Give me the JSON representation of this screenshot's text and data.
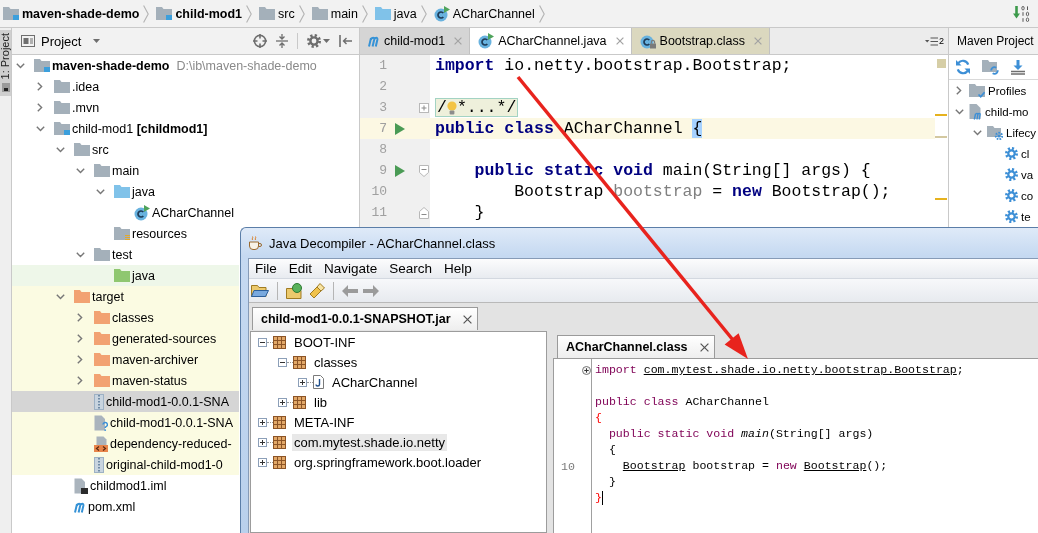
{
  "breadcrumbs": [
    {
      "label": "maven-shade-demo",
      "kind": "module"
    },
    {
      "label": "child-mod1",
      "kind": "module"
    },
    {
      "label": "src",
      "kind": "folder"
    },
    {
      "label": "main",
      "kind": "folder"
    },
    {
      "label": "java",
      "kind": "source-folder"
    },
    {
      "label": "ACharChannel",
      "kind": "class"
    }
  ],
  "tool_window_bar": {
    "buttons": [
      {
        "label": "1: Project",
        "selected": true
      }
    ]
  },
  "project_panel": {
    "title": "Project",
    "tree": [
      {
        "label": "maven-shade-demo",
        "kind": "root-module",
        "path": "D:\\ib\\maven-shade-demo",
        "expanded": true,
        "selected": false,
        "children": [
          {
            "label": ".idea",
            "kind": "folder",
            "expanded": false,
            "selected": false
          },
          {
            "label": ".mvn",
            "kind": "folder",
            "expanded": false,
            "selected": false
          },
          {
            "label": "child-mod1 **[childmod1]**",
            "kind": "module",
            "expanded": true,
            "selected": false,
            "children": [
              {
                "label": "src",
                "kind": "folder",
                "expanded": true,
                "selected": false,
                "children": [
                  {
                    "label": "main",
                    "kind": "folder",
                    "expanded": true,
                    "selected": false,
                    "children": [
                      {
                        "label": "java",
                        "kind": "source-folder",
                        "expanded": true,
                        "selected": false,
                        "children": [
                          {
                            "label": "ACharChannel",
                            "kind": "class",
                            "selected": false
                          }
                        ]
                      },
                      {
                        "label": "resources",
                        "kind": "resource-folder",
                        "selected": false
                      }
                    ]
                  },
                  {
                    "label": "test",
                    "kind": "folder",
                    "expanded": true,
                    "selected": false,
                    "children": [
                      {
                        "label": "java",
                        "kind": "test-folder",
                        "color": "#eef7e9",
                        "selected": false
                      }
                    ]
                  }
                ]
              },
              {
                "label": "target",
                "kind": "excluded-folder",
                "color": "#fbfbe2",
                "expanded": true,
                "selected": false,
                "children": [
                  {
                    "label": "classes",
                    "kind": "excluded-folder",
                    "color": "#fbfbe2",
                    "expanded": false,
                    "selected": false
                  },
                  {
                    "label": "generated-sources",
                    "kind": "excluded-folder",
                    "color": "#fbfbe2",
                    "expanded": false,
                    "selected": false
                  },
                  {
                    "label": "maven-archiver",
                    "kind": "excluded-folder",
                    "color": "#fbfbe2",
                    "expanded": false,
                    "selected": false
                  },
                  {
                    "label": "maven-status",
                    "kind": "excluded-folder",
                    "color": "#fbfbe2",
                    "expanded": false,
                    "selected": false
                  },
                  {
                    "label": "child-mod1-0.0.1-SNA",
                    "kind": "archive",
                    "selected": true
                  },
                  {
                    "label": "child-mod1-0.0.1-SNA",
                    "kind": "unknown",
                    "color": "#fbfbe2",
                    "selected": false
                  },
                  {
                    "label": "dependency-reduced-",
                    "kind": "xml",
                    "color": "#fbfbe2",
                    "selected": false
                  },
                  {
                    "label": "original-child-mod1-0",
                    "kind": "archive",
                    "color": "#fbfbe2",
                    "selected": false
                  }
                ]
              },
              {
                "label": "childmod1.iml",
                "kind": "iml",
                "selected": false
              },
              {
                "label": "pom.xml",
                "kind": "maven",
                "selected": false
              }
            ]
          }
        ]
      }
    ]
  },
  "editor": {
    "tabs": [
      {
        "label": "child-mod1",
        "kind": "maven",
        "selected": false
      },
      {
        "label": "ACharChannel.java",
        "kind": "class",
        "selected": true
      },
      {
        "label": "Bootstrap.class",
        "kind": "library-class",
        "selected": false
      }
    ],
    "hidden_tabs": "2",
    "lines": [
      {
        "number": "1",
        "current": false,
        "run": false,
        "tokens": [
          {
            "kind": "keyword",
            "text": "import"
          },
          {
            "kind": "plain",
            "text": " io.netty.bootstrap.Bootstrap;"
          }
        ]
      },
      {
        "number": "2",
        "current": false,
        "run": false
      },
      {
        "number": "3",
        "current": false,
        "run": false,
        "fold": {
          "kind": "expand"
        },
        "tokens": [
          {
            "kind": "folded",
            "text": "/",
            "rest": "*...*/"
          }
        ]
      },
      {
        "number": "7",
        "current": true,
        "run": true,
        "tokens": [
          {
            "kind": "keyword",
            "text": "public class"
          },
          {
            "kind": "plain",
            "text": " ACharChannel "
          },
          {
            "kind": "brace-match",
            "text": "{"
          }
        ]
      },
      {
        "number": "8",
        "current": false,
        "run": false
      },
      {
        "number": "9",
        "current": false,
        "run": true,
        "fold": {
          "kind": "collapse"
        },
        "tokens": [
          {
            "kind": "keyword",
            "text": "    public static void"
          },
          {
            "kind": "plain",
            "text": " main(String[] args) {"
          }
        ]
      },
      {
        "number": "10",
        "current": false,
        "run": false,
        "tokens": [
          {
            "kind": "plain",
            "text": "        Bootstrap "
          },
          {
            "kind": "unused",
            "text": "bootstrap"
          },
          {
            "kind": "plain",
            "text": " = "
          },
          {
            "kind": "keyword",
            "text": "new"
          },
          {
            "kind": "plain",
            "text": " Bootstrap();"
          }
        ]
      },
      {
        "number": "11",
        "current": false,
        "run": false,
        "fold": {
          "kind": "collapse-end"
        },
        "tokens": [
          {
            "kind": "plain",
            "text": "    }"
          }
        ]
      }
    ]
  },
  "maven_panel": {
    "title": "Maven Project",
    "tree": [
      {
        "label": "Profiles",
        "kind": "profiles",
        "expanded": false,
        "selected": false
      },
      {
        "label": "child-mo",
        "kind": "project",
        "expanded": true,
        "selected": false,
        "children": [
          {
            "label": "Lifecy",
            "kind": "lifecycle",
            "expanded": true,
            "selected": false,
            "children": [
              {
                "label": "cl",
                "kind": "phase",
                "selected": false
              },
              {
                "label": "va",
                "kind": "phase",
                "selected": false
              },
              {
                "label": "co",
                "kind": "phase",
                "selected": false
              },
              {
                "label": "te",
                "kind": "phase",
                "selected": false
              }
            ]
          }
        ]
      }
    ]
  },
  "decompiler": {
    "title": "Java Decompiler - ACharChannel.class",
    "menu": [
      "File",
      "Edit",
      "Navigate",
      "Search",
      "Help"
    ],
    "file_tabs": [
      {
        "label": "child-mod1-0.0.1-SNAPSHOT.jar",
        "selected": true
      }
    ],
    "tree": [
      {
        "label": "BOOT-INF",
        "kind": "package",
        "expanded": true,
        "selected": false,
        "children": [
          {
            "label": "classes",
            "kind": "package",
            "expanded": true,
            "selected": false,
            "children": [
              {
                "label": "ACharChannel",
                "kind": "class-file",
                "expanded": false,
                "selected": false
              }
            ]
          },
          {
            "label": "lib",
            "kind": "package",
            "expanded": false,
            "selected": false
          }
        ]
      },
      {
        "label": "META-INF",
        "kind": "package",
        "expanded": false,
        "selected": false
      },
      {
        "label": "com.mytest.shade.io.netty",
        "kind": "package",
        "expanded": false,
        "selected": true
      },
      {
        "label": "org.springframework.boot.loader",
        "kind": "package",
        "expanded": false,
        "selected": false
      }
    ],
    "code_tabs": [
      {
        "label": "ACharChannel.class",
        "selected": true
      }
    ],
    "lines": [
      {
        "fold": {
          "kind": "expand"
        },
        "caret": false,
        "tokens": [
          {
            "kind": "keyword",
            "text": "import "
          },
          {
            "kind": "link",
            "text": "com.mytest.shade.io.netty.bootstrap.Bootstrap"
          },
          {
            "kind": "plain",
            "text": ";"
          }
        ]
      },
      {
        "caret": false
      },
      {
        "caret": false,
        "tokens": [
          {
            "kind": "keyword",
            "text": "public class"
          },
          {
            "kind": "plain",
            "text": " ACharChannel"
          }
        ]
      },
      {
        "caret": false,
        "tokens": [
          {
            "kind": "brace-match",
            "text": "{"
          }
        ]
      },
      {
        "caret": false,
        "tokens": [
          {
            "kind": "keyword",
            "text": "  public static void "
          },
          {
            "kind": "method",
            "text": "main"
          },
          {
            "kind": "plain",
            "text": "(String[] args)"
          }
        ]
      },
      {
        "caret": false,
        "tokens": [
          {
            "kind": "plain",
            "text": "  {"
          }
        ]
      },
      {
        "number": "10",
        "caret": false,
        "tokens": [
          {
            "kind": "link",
            "text": "    Bootstrap"
          },
          {
            "kind": "plain",
            "text": " bootstrap = "
          },
          {
            "kind": "keyword",
            "text": "new "
          },
          {
            "kind": "link",
            "text": "Bootstrap"
          },
          {
            "kind": "plain",
            "text": "();"
          }
        ]
      },
      {
        "caret": false,
        "tokens": [
          {
            "kind": "plain",
            "text": "  }"
          }
        ]
      },
      {
        "caret": true,
        "tokens": [
          {
            "kind": "brace-match",
            "text": "}"
          }
        ]
      }
    ]
  }
}
